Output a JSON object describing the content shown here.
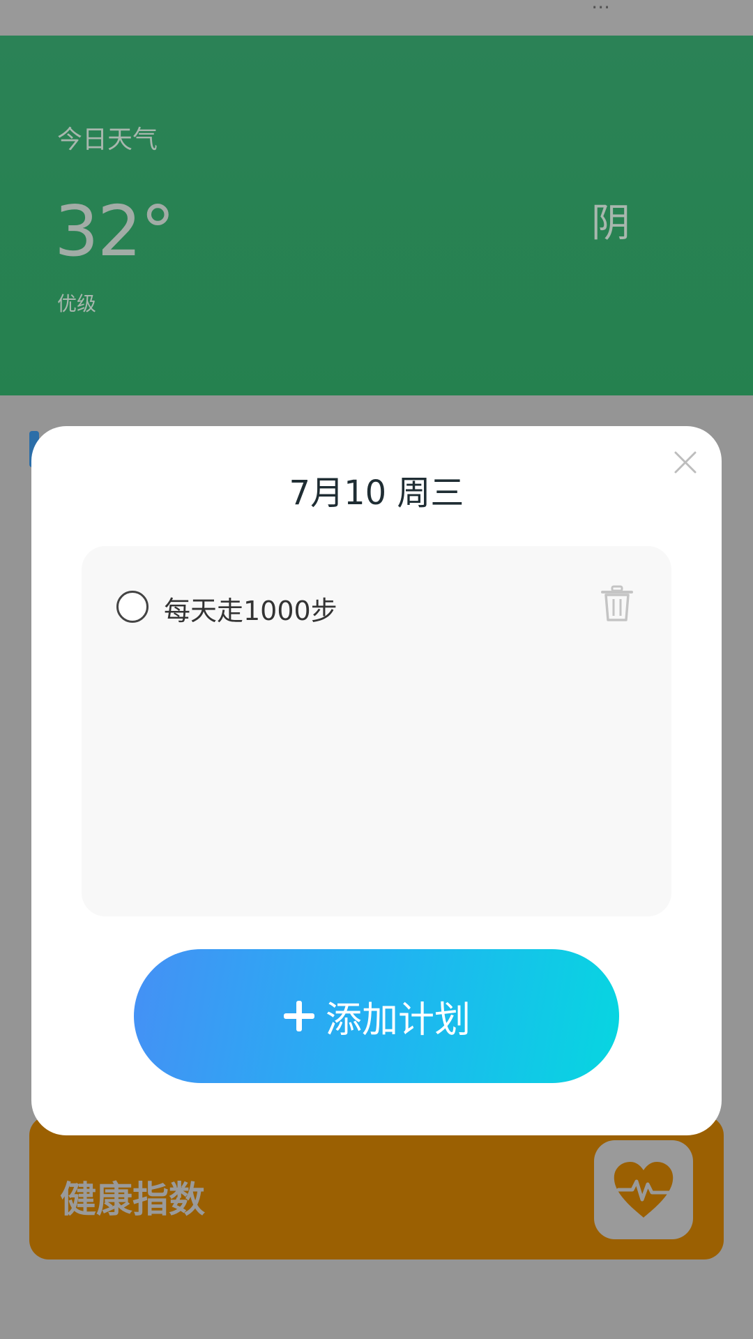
{
  "status_bar": {
    "text": "..."
  },
  "weather": {
    "title": "今日天气",
    "temperature": "32°",
    "quality": "优级",
    "condition": "阴"
  },
  "health": {
    "title": "健康指数",
    "icon": "heart-pulse-icon"
  },
  "modal": {
    "date": "7月10  周三",
    "close_icon": "close-icon",
    "plans": [
      {
        "text": "每天走1000步",
        "checked": false
      }
    ],
    "add_button": {
      "label": "添加计划",
      "icon": "plus-icon"
    }
  },
  "colors": {
    "overlay": "#959595",
    "weather_bg": "#2b8256",
    "health_bg": "#9b6002",
    "button_gradient_start": "#4590f5",
    "button_gradient_end": "#07d6e0"
  }
}
